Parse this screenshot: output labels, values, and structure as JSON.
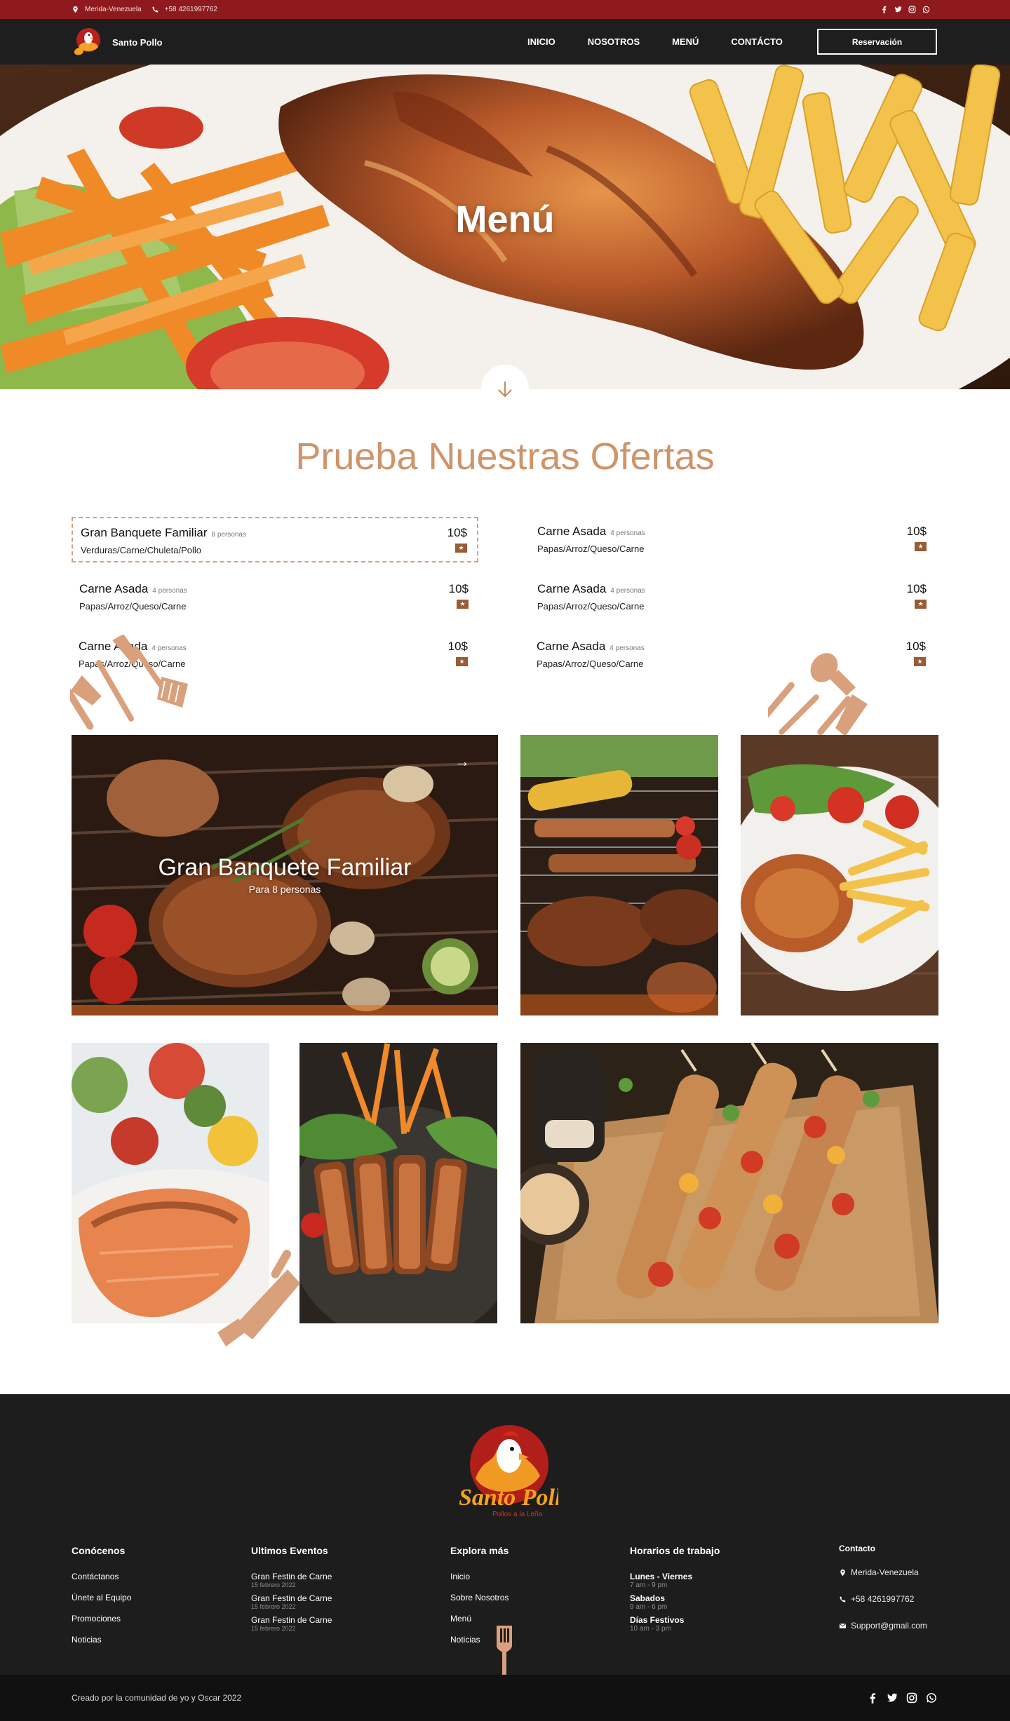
{
  "topbar": {
    "location": "Merida-Venezuela",
    "phone": "+58 4261997762",
    "social_icons": [
      "facebook-icon",
      "twitter-icon",
      "instagram-icon",
      "whatsapp-icon"
    ]
  },
  "nav": {
    "brand": "Santo Pollo",
    "items": [
      "INICIO",
      "NOSOTROS",
      "MENÚ",
      "CONTÁCTO"
    ],
    "reserve_label": "Reservación"
  },
  "hero": {
    "title": "Menú"
  },
  "offers": {
    "title": "Prueba Nuestras Ofertas",
    "items": [
      {
        "name": "Gran Banquete Familiar",
        "people": "8 personas",
        "desc": "Verduras/Carne/Chuleta/Pollo",
        "price": "10$"
      },
      {
        "name": "Carne Asada",
        "people": "4 personas",
        "desc": "Papas/Arroz/Queso/Carne",
        "price": "10$"
      },
      {
        "name": "Carne Asada",
        "people": "4 personas",
        "desc": "Papas/Arroz/Queso/Carne",
        "price": "10$"
      },
      {
        "name": "Carne Asada",
        "people": "4 personas",
        "desc": "Papas/Arroz/Queso/Carne",
        "price": "10$"
      },
      {
        "name": "Carne Asada",
        "people": "4 personas",
        "desc": "Papas/Arroz/Queso/Carne",
        "price": "10$"
      },
      {
        "name": "Carne Asada",
        "people": "4 personas",
        "desc": "Papas/Arroz/Queso/Carne",
        "price": "10$"
      }
    ]
  },
  "gallery": {
    "featured_title": "Gran Banquete Familiar",
    "featured_subtitle": "Para 8 personas"
  },
  "footer": {
    "logo_text": "Santo Pollo",
    "logo_tagline": "Pollos a la Leña",
    "col1": {
      "title": "Conócenos",
      "links": [
        "Contáctanos",
        "Únete al Equipo",
        "Promociones",
        "Noticias"
      ]
    },
    "col2": {
      "title": "Ultimos Eventos",
      "events": [
        {
          "name": "Gran Festin de Carne",
          "date": "15 febrero 2022"
        },
        {
          "name": "Gran Festin de Carne",
          "date": "15 febrero 2022"
        },
        {
          "name": "Gran Festin de Carne",
          "date": "15 febrero 2022"
        }
      ]
    },
    "col3": {
      "title": "Explora más",
      "links": [
        "Inicio",
        "Sobre Nosotros",
        "Menú",
        "Noticias"
      ]
    },
    "col4": {
      "title": "Horarios de trabajo",
      "hours": [
        {
          "day": "Lunes - Viernes",
          "time": "7 am - 9 pm"
        },
        {
          "day": "Sabados",
          "time": "9 am - 6 pm"
        },
        {
          "day": "Días Festivos",
          "time": "10 am - 3 pm"
        }
      ]
    },
    "col5": {
      "title": "Contacto",
      "location": "Merida-Venezuela",
      "phone": "+58 4261997762",
      "email": "Support@gmail.com"
    },
    "copyright": "Creado por la comunidad de yo y Oscar 2022"
  },
  "colors": {
    "topbar": "#8f1a1d",
    "nav": "#1e1e1e",
    "accent": "#cf9469",
    "footer": "#1d1d1d"
  }
}
